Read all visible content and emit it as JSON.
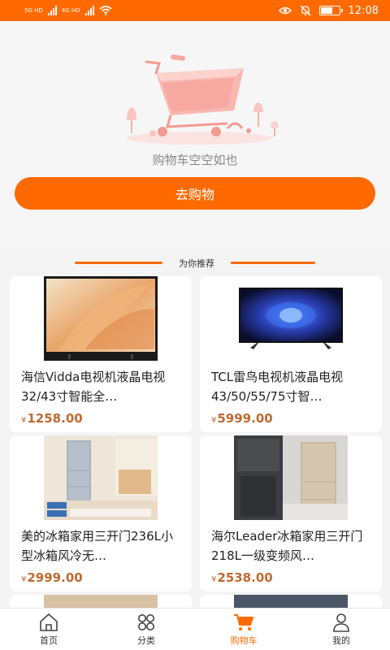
{
  "status_bar": {
    "net_label_1": "5G HD",
    "net_label_2": "4G HD",
    "time": "12:08",
    "battery_level": 0.7
  },
  "empty_cart": {
    "message": "购物车空空如也",
    "button_label": "去购物"
  },
  "recommend": {
    "label": "为你推荐"
  },
  "products": [
    {
      "title": "海信Vidda电视机液晶电视32/43寸智能全…",
      "currency": "¥",
      "price": "1258.00"
    },
    {
      "title": "TCL雷鸟电视机液晶电视43/50/55/75寸智…",
      "currency": "¥",
      "price": "5999.00"
    },
    {
      "title": "美的冰箱家用三开门236L小型冰箱风冷无…",
      "currency": "¥",
      "price": "2999.00"
    },
    {
      "title": "海尔Leader冰箱家用三开门218L一级变频风…",
      "currency": "¥",
      "price": "2538.00"
    }
  ],
  "nav": {
    "items": [
      {
        "label": "首页",
        "icon": "home-icon"
      },
      {
        "label": "分类",
        "icon": "category-icon"
      },
      {
        "label": "购物车",
        "icon": "cart-icon"
      },
      {
        "label": "我的",
        "icon": "user-icon"
      }
    ],
    "active_index": 2
  },
  "colors": {
    "accent": "#ff6a00",
    "price": "#c06a2e"
  }
}
